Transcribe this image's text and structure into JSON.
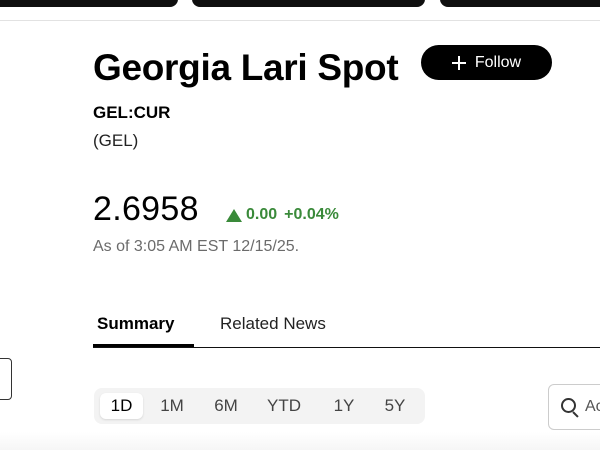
{
  "header": {
    "title": "Georgia Lari Spot",
    "follow_label": "Follow",
    "ticker": "GEL:CUR",
    "currency_code": "(GEL)"
  },
  "quote": {
    "price": "2.6958",
    "change": "0.00",
    "change_percent": "+0.04%",
    "direction": "up",
    "as_of": "As of 3:05 AM EST 12/15/25."
  },
  "tabs": [
    {
      "label": "Summary",
      "active": true
    },
    {
      "label": "Related News",
      "active": false
    }
  ],
  "time_ranges": {
    "options": [
      "1D",
      "1M",
      "6M",
      "YTD",
      "1Y",
      "5Y"
    ],
    "selected": "1D"
  },
  "search": {
    "placeholder": "Ac",
    "icon": "search-icon"
  },
  "icons": {
    "follow": "plus-icon",
    "change": "up-arrow-icon"
  },
  "colors": {
    "positive": "#3a8a3a",
    "button_bg": "#000000",
    "muted_text": "#6b6b6b"
  }
}
